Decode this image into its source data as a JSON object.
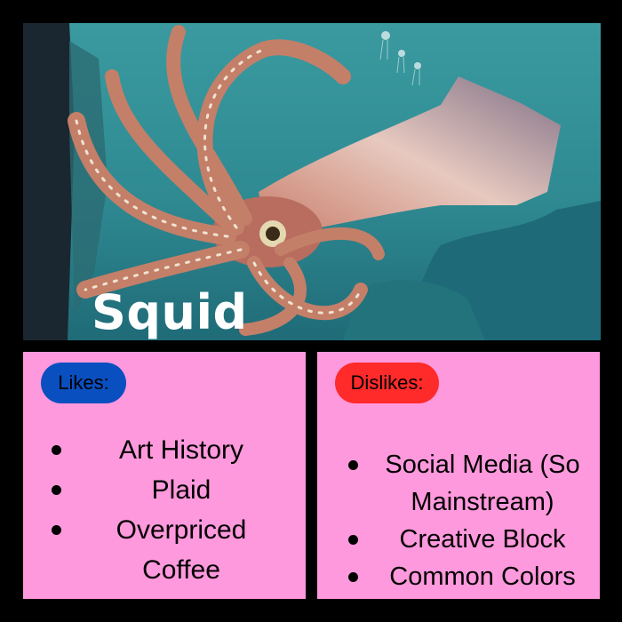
{
  "hero": {
    "title": "Squid",
    "image_description_icon": "giant-squid-illustration"
  },
  "likes": {
    "label": "Likes:",
    "color": "#0a4fc0",
    "items": [
      "Art History",
      "Plaid",
      "Overpriced Coffee"
    ]
  },
  "dislikes": {
    "label": "Dislikes:",
    "color": "#ff2a2a",
    "items": [
      "Social Media (So Mainstream)",
      "Creative Block",
      "Common Colors"
    ]
  },
  "colors": {
    "background": "#000000",
    "card": "#ff99dd",
    "water": "#2f8c93"
  }
}
